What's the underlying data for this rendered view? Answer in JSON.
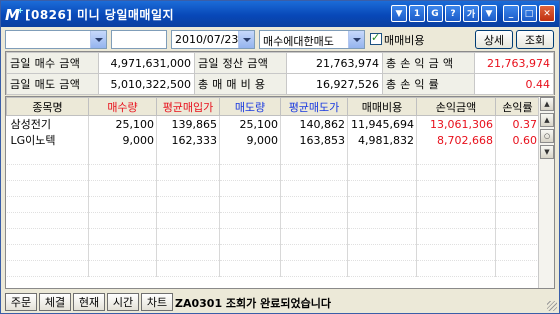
{
  "window": {
    "title": "[0826] 미니 당일매매일지",
    "title_buttons": [
      "▼",
      "1",
      "G",
      "?",
      "가",
      "▼",
      "_",
      "□",
      "✕"
    ]
  },
  "toolbar": {
    "account_value": "",
    "code_value": "",
    "date_value": "2010/07/23",
    "type_value": "매수에대한매도",
    "fee_checkbox_label": "매매비용",
    "fee_checked": true,
    "detail_button": "상세",
    "query_button": "조회"
  },
  "summary": {
    "rows": [
      {
        "l1": "금일 매수 금액",
        "v1": "4,971,631,000",
        "l2": "금일 정산 금액",
        "v2": "21,763,974",
        "l3": "총 손 익 금 액",
        "v3": "21,763,974"
      },
      {
        "l1": "금일 매도 금액",
        "v1": "5,010,322,500",
        "l2": "총 매 매 비 용",
        "v2": "16,927,526",
        "l3": "총 손 익 률",
        "v3": "0.44"
      }
    ]
  },
  "grid": {
    "headers": [
      "종목명",
      "매수량",
      "평균매입가",
      "매도량",
      "평균매도가",
      "매매비용",
      "손익금액",
      "손익률"
    ],
    "header_colors": [
      "#000000",
      "#e8101c",
      "#e8101c",
      "#1838e0",
      "#1838e0",
      "#000000",
      "#000000",
      "#000000"
    ],
    "rows": [
      {
        "name": "삼성전기",
        "buy_qty": "25,100",
        "avg_buy": "139,865",
        "sell_qty": "25,100",
        "avg_sell": "140,862",
        "fee": "11,945,694",
        "pnl": "13,061,306",
        "pnl_rate": "0.37"
      },
      {
        "name": "LG이노텍",
        "buy_qty": "9,000",
        "avg_buy": "162,333",
        "sell_qty": "9,000",
        "avg_sell": "163,853",
        "fee": "4,981,832",
        "pnl": "8,702,668",
        "pnl_rate": "0.60"
      }
    ]
  },
  "statusbar": {
    "buttons": [
      "주문",
      "체결",
      "현재",
      "시간",
      "차트"
    ],
    "message": "ZA0301 조회가 완료되었습니다"
  },
  "colors": {
    "profit": "#e8101c",
    "buy": "#e8101c",
    "sell": "#1838e0",
    "titlebar": "#0848b8"
  }
}
